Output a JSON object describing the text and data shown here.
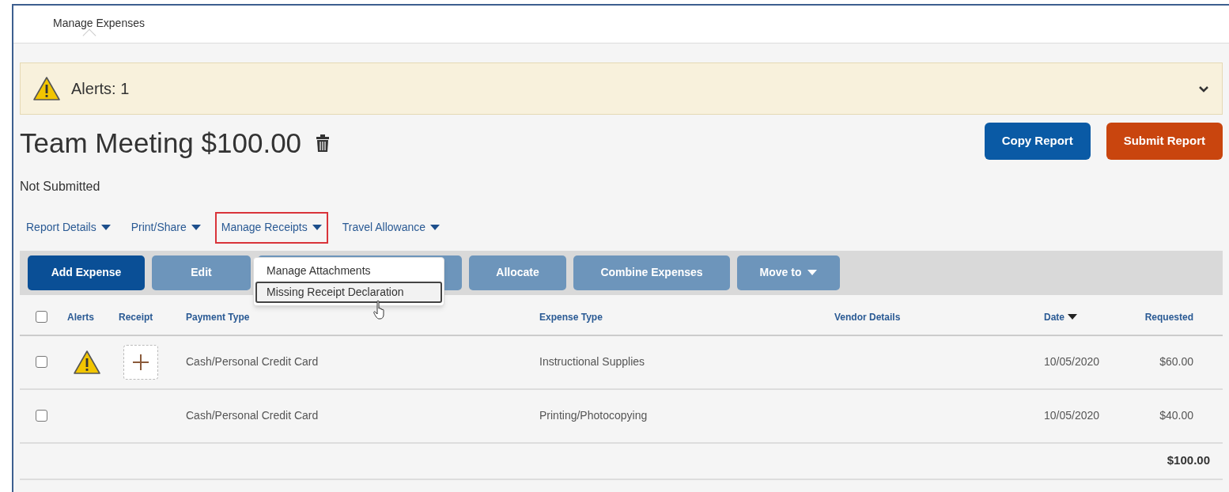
{
  "tabs": [
    {
      "label": "Manage Expenses",
      "selected": true
    }
  ],
  "alert_bar": {
    "text": "Alerts: 1",
    "expanded": false
  },
  "report": {
    "title": "Team Meeting $100.00",
    "status": "Not Submitted"
  },
  "header_buttons": [
    {
      "label": "Copy Report",
      "kind": "primary"
    },
    {
      "label": "Submit Report",
      "kind": "submit"
    }
  ],
  "report_menus": [
    {
      "label": "Report Details",
      "outlined": false
    },
    {
      "label": "Print/Share",
      "outlined": false
    },
    {
      "label": "Manage Receipts",
      "outlined": true
    },
    {
      "label": "Travel Allowance",
      "outlined": false
    }
  ],
  "toolbar": [
    {
      "label": "Add Expense",
      "disabled": false,
      "kind": "button"
    },
    {
      "label": "Edit",
      "disabled": true,
      "kind": "button"
    },
    {
      "disabled": true,
      "kind": "covered"
    },
    {
      "label": "Allocate",
      "disabled": true,
      "kind": "button"
    },
    {
      "label": "Combine Expenses",
      "disabled": true,
      "kind": "button"
    },
    {
      "label": "Move to",
      "disabled": true,
      "kind": "menu"
    }
  ],
  "receipts_menu": [
    {
      "label": "Manage Attachments",
      "selected": false
    },
    {
      "label": "Missing Receipt Declaration",
      "selected": true
    }
  ],
  "table": {
    "select_all_checked": false,
    "columns": [
      {
        "label": "Alerts",
        "sorted": false
      },
      {
        "label": "Receipt",
        "sorted": false
      },
      {
        "label": "Payment Type",
        "sorted": false
      },
      {
        "label": "Expense Type",
        "sorted": false
      },
      {
        "label": "Vendor Details",
        "sorted": false
      },
      {
        "label": "Date",
        "sorted": true
      },
      {
        "label": "Requested",
        "sorted": false
      }
    ],
    "rows": [
      {
        "checked": false,
        "alert": true,
        "receipt_missing": true,
        "payment_type": "Cash/Personal Credit Card",
        "expense_type": "Instructional Supplies",
        "date": "10/05/2020",
        "requested": "$60.00"
      },
      {
        "checked": false,
        "alert": false,
        "receipt_missing": false,
        "payment_type": "Cash/Personal Credit Card",
        "expense_type": "Printing/Photocopying",
        "date": "10/05/2020",
        "requested": "$40.00"
      }
    ],
    "total": "$100.00"
  }
}
